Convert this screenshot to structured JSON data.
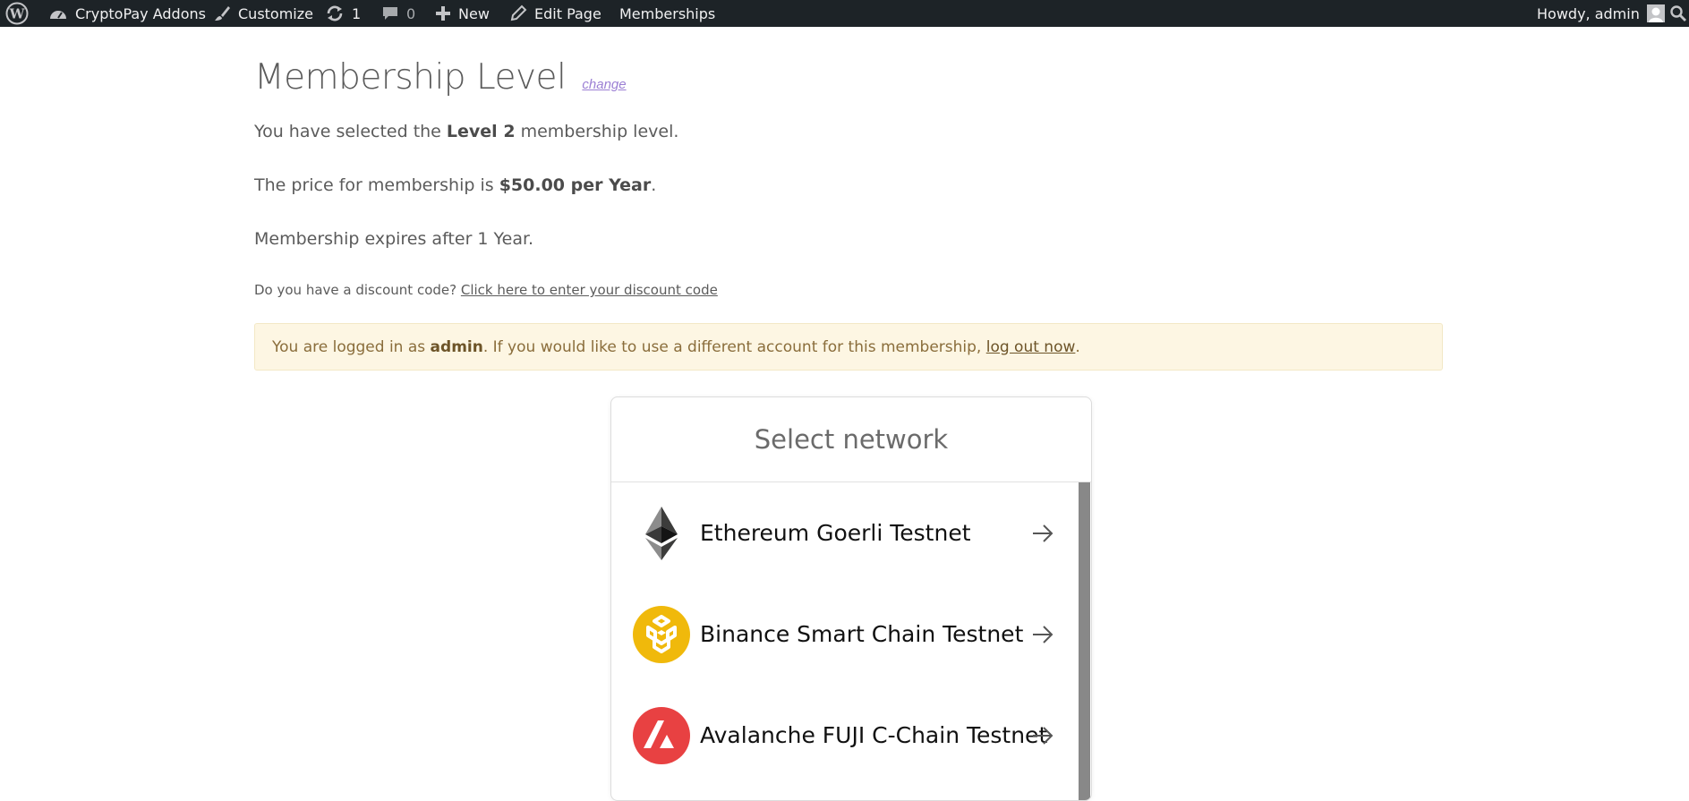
{
  "adminbar": {
    "site_name": "CryptoPay Addons",
    "customize": "Customize",
    "updates_count": "1",
    "comments_count": "0",
    "new": "New",
    "edit_page": "Edit Page",
    "memberships": "Memberships",
    "howdy": "Howdy, admin"
  },
  "level": {
    "title": "Membership Level",
    "change": "change",
    "selected_prefix": "You have selected the ",
    "selected_level": "Level 2",
    "selected_suffix": " membership level.",
    "price_prefix": "The price for membership is ",
    "price_value": "$50.00 per Year",
    "price_suffix": ".",
    "expires": "Membership expires after 1 Year.",
    "discount_question": "Do you have a discount code?",
    "discount_link": "Click here to enter your discount code"
  },
  "notice": {
    "prefix": "You are logged in as ",
    "user": "admin",
    "middle": ". If you would like to use a different account for this membership, ",
    "logout": "log out now",
    "suffix": "."
  },
  "network_selector": {
    "title": "Select network",
    "networks": [
      {
        "name": "Ethereum Goerli Testnet",
        "icon": "ethereum-icon"
      },
      {
        "name": "Binance Smart Chain Testnet",
        "icon": "bnb-icon"
      },
      {
        "name": "Avalanche FUJI C-Chain Testnet",
        "icon": "avalanche-icon"
      }
    ]
  },
  "colors": {
    "adminbar_bg": "#1d2327",
    "notice_bg": "#fdf6e3",
    "bnb": "#f0b90b",
    "avalanche": "#e84142"
  }
}
